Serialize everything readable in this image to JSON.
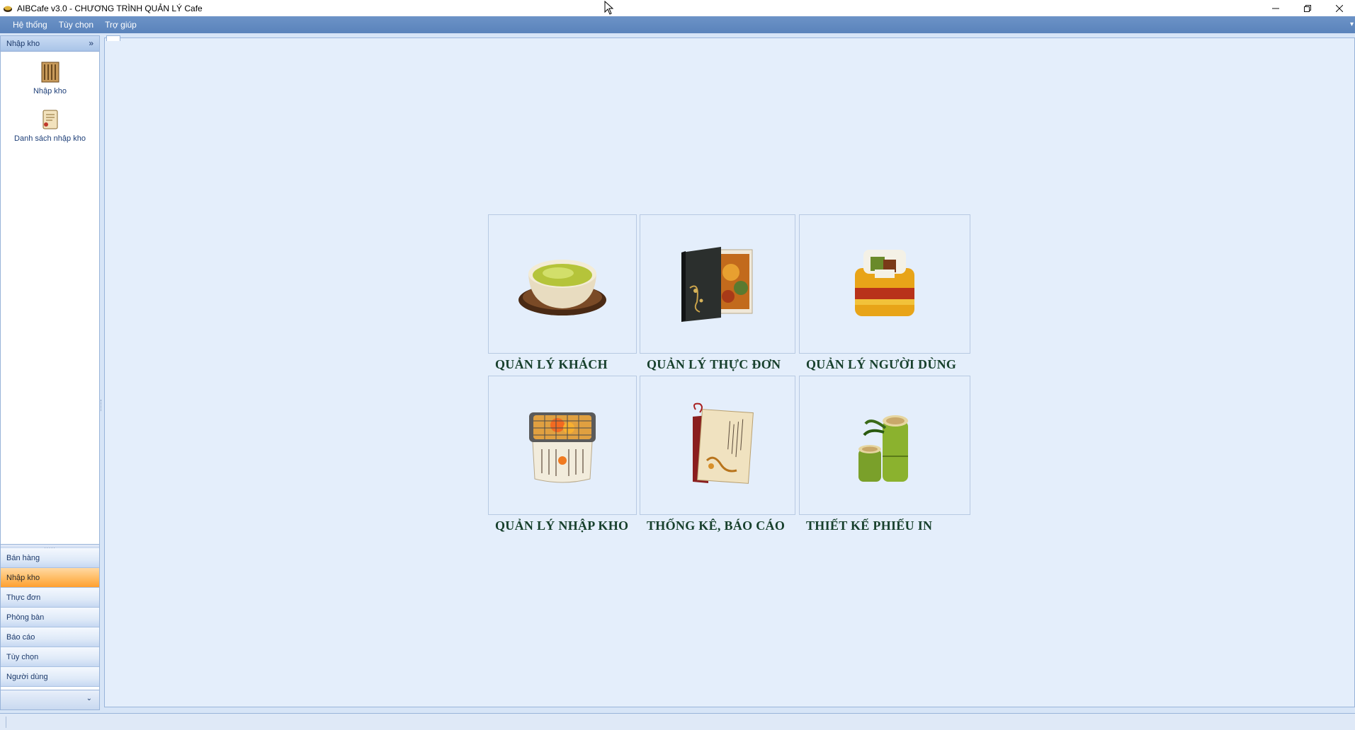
{
  "window": {
    "title": "AIBCafe v3.0 - CHƯƠNG TRÌNH QUẢN LÝ Cafe",
    "controls": [
      "minimize-icon",
      "restore-icon",
      "close-icon"
    ]
  },
  "menubar": {
    "items": [
      "Hệ thống",
      "Tùy chọn",
      "Trợ giúp"
    ]
  },
  "sidebar": {
    "header": "Nhập kho",
    "items": [
      {
        "label": "Nhập kho",
        "icon": "warehouse-icon"
      },
      {
        "label": "Danh sách nhập kho",
        "icon": "list-scroll-icon"
      }
    ],
    "groups": [
      "Bán hàng",
      "Nhập kho",
      "Thực đơn",
      "Phòng bàn",
      "Báo cáo",
      "Tùy chọn",
      "Người dùng"
    ],
    "active_group": "Nhập kho"
  },
  "tiles": [
    {
      "label": "QUẢN LÝ KHÁCH",
      "icon": "tea-cup-icon"
    },
    {
      "label": "QUẢN LÝ THỰC ĐƠN",
      "icon": "menu-book-icon"
    },
    {
      "label": "QUẢN LÝ NGƯỜI DÙNG",
      "icon": "gift-box-icon"
    },
    {
      "label": "QUẢN LÝ NHẬP KHO",
      "icon": "grill-box-icon"
    },
    {
      "label": "THỐNG KÊ, BÁO CÁO",
      "icon": "report-scroll-icon"
    },
    {
      "label": "THIẾT KẾ PHIẾU IN",
      "icon": "bamboo-cups-icon"
    }
  ],
  "colors": {
    "menubar": "#5a83bb",
    "workspace": "#d7e5f7",
    "active_group": "#ffb85c",
    "tile_label": "#17402c"
  }
}
